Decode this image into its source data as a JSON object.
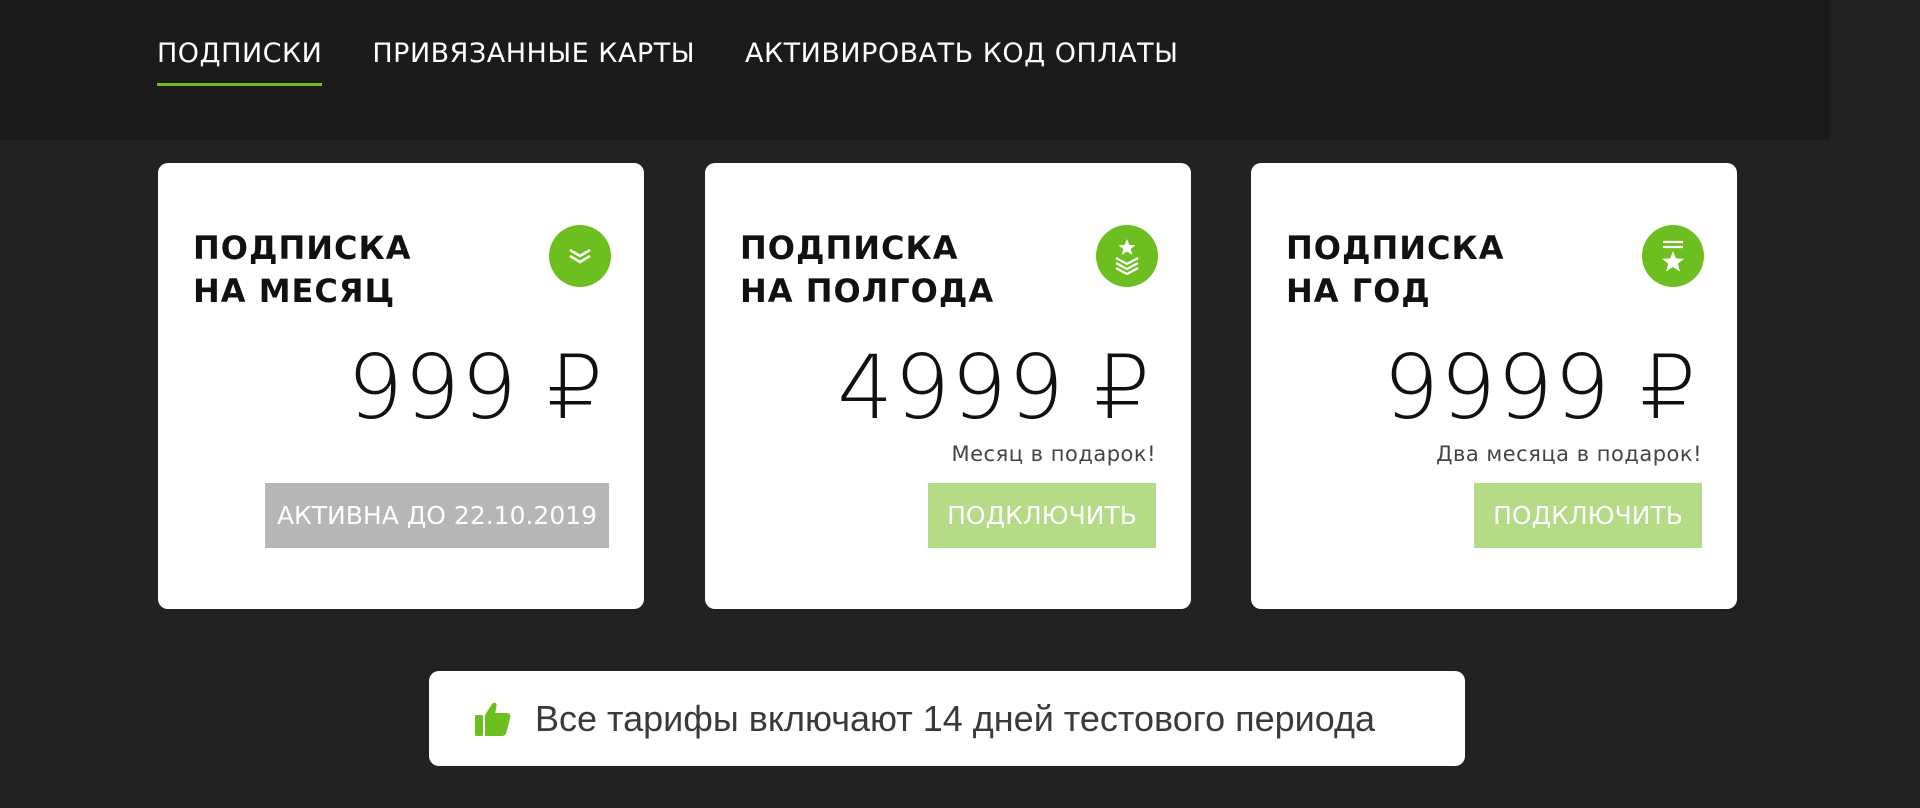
{
  "tabs": [
    {
      "label": "ПОДПИСКИ",
      "active": true
    },
    {
      "label": "ПРИВЯЗАННЫЕ КАРТЫ",
      "active": false
    },
    {
      "label": "АКТИВИРОВАТЬ КОД ОПЛАТЫ",
      "active": false
    }
  ],
  "plans": [
    {
      "title_line1": "ПОДПИСКА",
      "title_line2": "НА МЕСЯЦ",
      "price": "999 ₽",
      "bonus": "",
      "button": "АКТИВНА ДО 22.10.2019",
      "icon": "chevron-rank-icon"
    },
    {
      "title_line1": "ПОДПИСКА",
      "title_line2": "НА ПОЛГОДА",
      "price": "4999 ₽",
      "bonus": "Месяц в подарок!",
      "button": "ПОДКЛЮЧИТЬ",
      "icon": "star-chevrons-rank-icon"
    },
    {
      "title_line1": "ПОДПИСКА",
      "title_line2": "НА ГОД",
      "price": "9999 ₽",
      "bonus": "Два месяца в подарок!",
      "button": "ПОДКЛЮЧИТЬ",
      "icon": "star-bars-rank-icon"
    }
  ],
  "notice": {
    "text": "Все тарифы включают 14 дней тестового периода",
    "icon": "thumbs-up-icon"
  },
  "colors": {
    "accent": "#6cbf1f",
    "button_connect": "#b4db85",
    "button_active": "#b6b6b6",
    "background": "#222222"
  }
}
